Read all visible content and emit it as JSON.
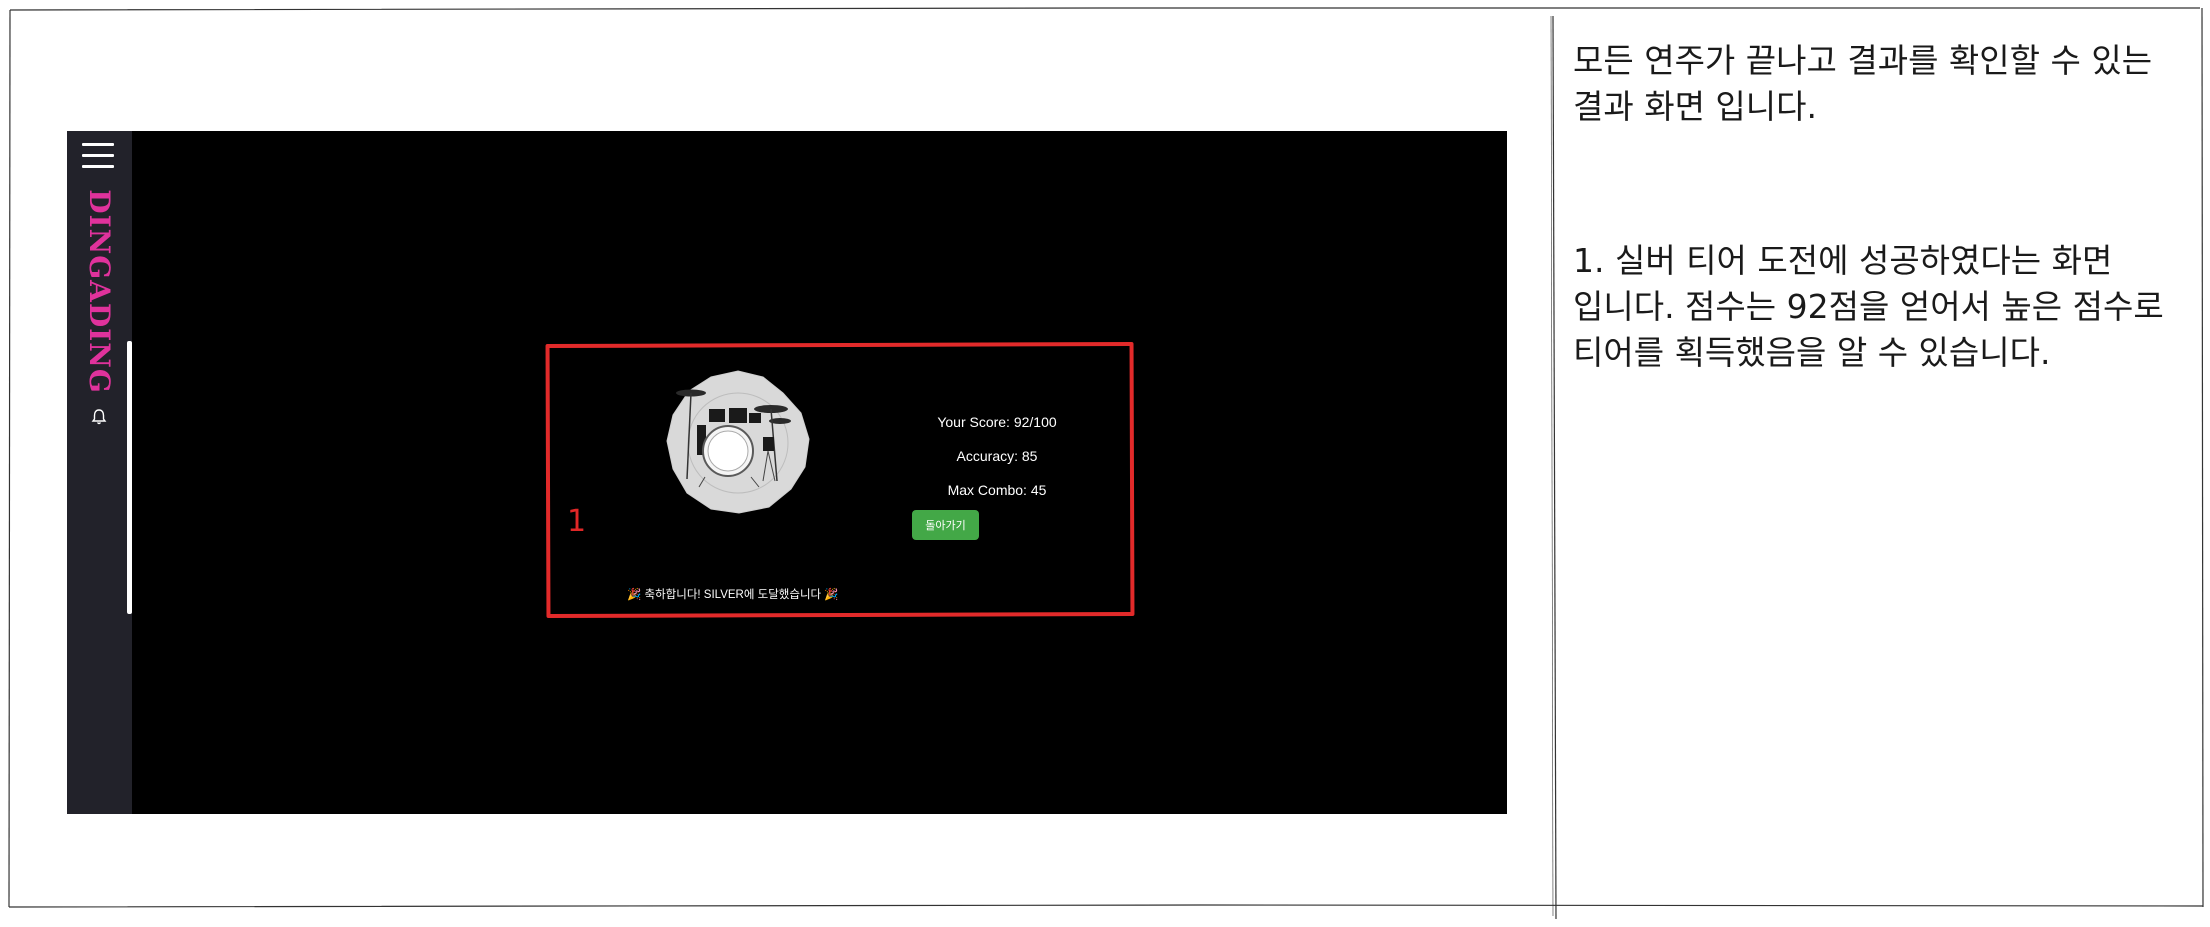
{
  "app": {
    "brand": "DINGADING",
    "icons": [
      "hamburger-menu-icon",
      "bell-icon"
    ]
  },
  "result": {
    "score_label": "Your Score: 92/100",
    "accuracy_label": "Accuracy: 85",
    "max_combo_label": "Max Combo: 45",
    "back_button_label": "돌아가기",
    "congrats_message": "🎉 축하합니다! SILVER에 도달했습니다 🎉",
    "score": 92,
    "score_max": 100,
    "accuracy": 85,
    "max_combo": 45,
    "tier": "SILVER"
  },
  "annotation": {
    "number": "1"
  },
  "description": {
    "intro": "모든 연주가 끝나고 결과를 확인할 수 있는 결과 화면 입니다.",
    "item_1": "1. 실버 티어 도전에 성공하였다는 화면 입니다. 점수는 92점을 얻어서 높은 점수로 티어를 획득했음을 알 수 있습니다."
  },
  "colors": {
    "background": "#ffffff",
    "app_background": "#000000",
    "sidebar": "#22222a",
    "brand": "#e0329c",
    "button": "#43a847",
    "annotation": "#e22a2a"
  }
}
